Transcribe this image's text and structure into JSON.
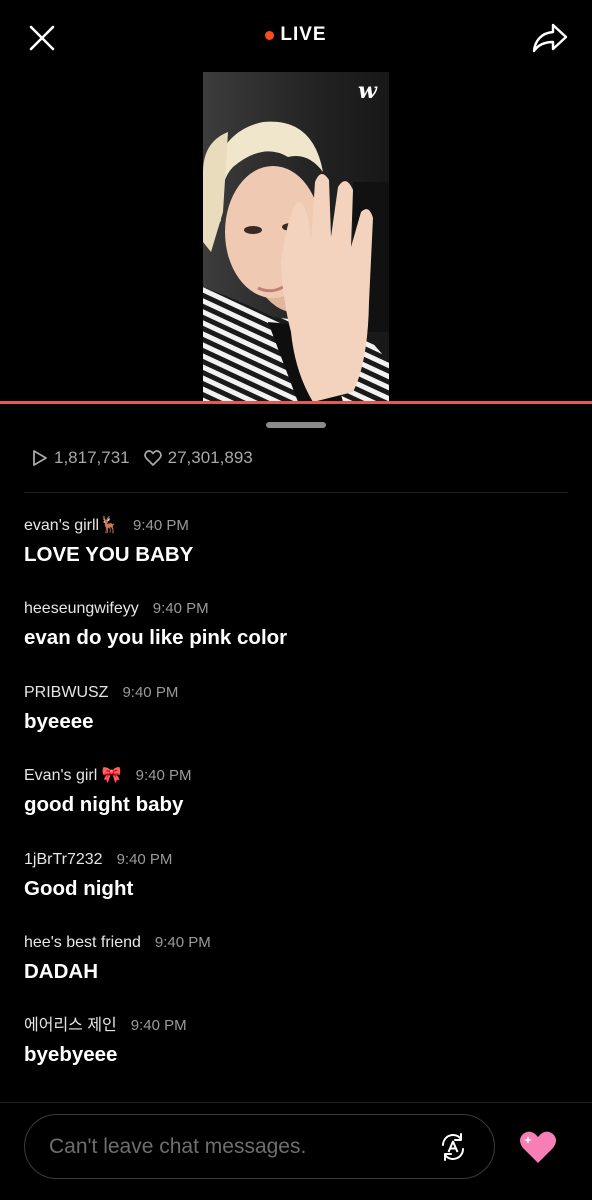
{
  "header": {
    "close_icon": "close-icon",
    "live_label": "LIVE",
    "live_dot_color": "#ff4a1c",
    "share_icon": "share-icon"
  },
  "video": {
    "watermark": "w"
  },
  "progress_color": "#e35a54",
  "stats": {
    "plays": "1,817,731",
    "likes": "27,301,893"
  },
  "messages": [
    {
      "user": "evan's girll🦌",
      "time": "9:40 PM",
      "text": "LOVE YOU BABY"
    },
    {
      "user": "heeseungwifeyy",
      "time": "9:40 PM",
      "text": "evan do you like pink color"
    },
    {
      "user": "PRIBWUSZ",
      "time": "9:40 PM",
      "text": "byeeee"
    },
    {
      "user": "Evan's girl 🎀",
      "time": "9:40 PM",
      "text": "good night baby"
    },
    {
      "user": "1jBrTr7232",
      "time": "9:40 PM",
      "text": "Good night"
    },
    {
      "user": "hee's best friend",
      "time": "9:40 PM",
      "text": "DADAH"
    },
    {
      "user": "에어리스 제인",
      "time": "9:40 PM",
      "text": "byebyeee"
    }
  ],
  "chat_input": {
    "placeholder": "Can't leave chat messages."
  },
  "heart_color": "#f77fb5"
}
